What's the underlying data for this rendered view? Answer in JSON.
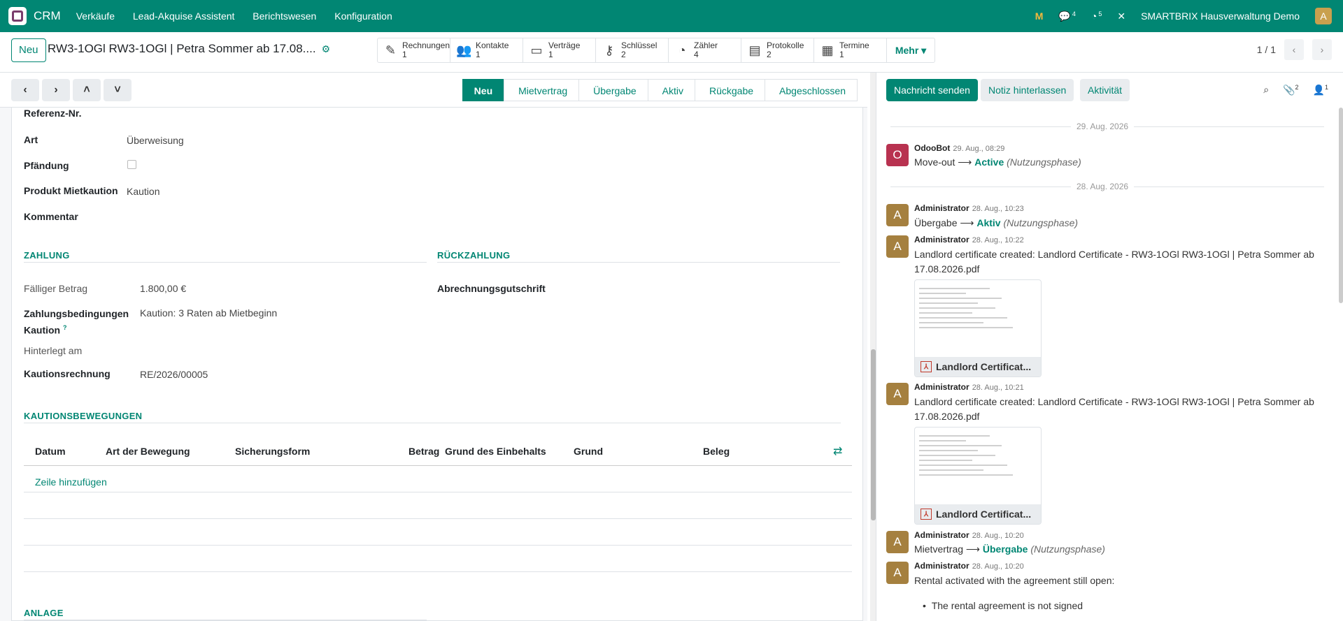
{
  "topbar": {
    "app": "CRM",
    "menu": [
      "Verkäufe",
      "Lead-Akquise Assistent",
      "Berichtswesen",
      "Konfiguration"
    ],
    "chat_badge": "4",
    "activity_badge": "5",
    "company": "SMARTBRIX Hausverwaltung Demo",
    "avatar": "A"
  },
  "control": {
    "new_label": "Neu",
    "record_title": "RW3-1OGl RW3-1OGl | Petra Sommer ab 17.08....",
    "pager": "1 / 1",
    "smart_buttons": [
      {
        "label": "Rechnungen",
        "count": "1",
        "icon": "✎"
      },
      {
        "label": "Kontakte",
        "count": "1",
        "icon": "👥"
      },
      {
        "label": "Verträge",
        "count": "1",
        "icon": "▭"
      },
      {
        "label": "Schlüssel",
        "count": "2",
        "icon": "⚷"
      },
      {
        "label": "Zähler",
        "count": "4",
        "icon": "◔"
      },
      {
        "label": "Protokolle",
        "count": "2",
        "icon": "▤"
      },
      {
        "label": "Termine",
        "count": "1",
        "icon": "▦"
      }
    ],
    "more_label": "Mehr"
  },
  "status": [
    "Neu",
    "Mietvertrag",
    "Übergabe",
    "Aktiv",
    "Rückgabe",
    "Abgeschlossen"
  ],
  "form": {
    "ref_label": "Referenz-Nr.",
    "art_label": "Art",
    "art_value": "Überweisung",
    "pfaendung_label": "Pfändung",
    "produkt_label": "Produkt Mietkaution",
    "produkt_value": "Kaution",
    "kommentar_label": "Kommentar",
    "zahlung_title": "ZAHLUNG",
    "rueck_title": "RÜCKZAHLUNG",
    "faellig_label": "Fälliger Betrag",
    "faellig_value": "1.800,00 €",
    "zb_label_1": "Zahlungsbedingungen",
    "zb_label_2": "Kaution",
    "zb_q": "?",
    "zb_value": "Kaution: 3 Raten ab Mietbeginn",
    "hinterlegt_label": "Hinterlegt am",
    "krech_label": "Kautionsrechnung",
    "krech_value": "RE/2026/00005",
    "abrech_label": "Abrechnungsgutschrift",
    "bew_title": "KAUTIONSBEWEGUNGEN",
    "columns": [
      "Datum",
      "Art der Bewegung",
      "Sicherungsform",
      "Betrag",
      "Grund des Einbehalts",
      "Grund",
      "Beleg"
    ],
    "add_line": "Zeile hinzufügen",
    "anlage_title": "ANLAGE"
  },
  "chatter": {
    "send": "Nachricht senden",
    "note": "Notiz hinterlassen",
    "activity": "Aktivität",
    "att_count": "2",
    "follow_count": "1",
    "date1": "29. Aug. 2026",
    "date2": "28. Aug. 2026",
    "m1": {
      "author": "OdooBot",
      "time": "29. Aug., 08:29",
      "from": "Move-out",
      "to": "Active",
      "phase": "(Nutzungsphase)",
      "av": "O"
    },
    "m2": {
      "author": "Administrator",
      "time": "28. Aug., 10:23",
      "from": "Übergabe",
      "to": "Aktiv",
      "phase": "(Nutzungsphase)",
      "av": "A"
    },
    "m3": {
      "author": "Administrator",
      "time": "28. Aug., 10:22",
      "text": "Landlord certificate created: Landlord Certificate - RW3-1OGl RW3-1OGl | Petra Sommer ab 17.08.2026.pdf",
      "att": "Landlord Certificat...",
      "av": "A"
    },
    "m4": {
      "author": "Administrator",
      "time": "28. Aug., 10:21",
      "text": "Landlord certificate created: Landlord Certificate - RW3-1OGl RW3-1OGl | Petra Sommer ab 17.08.2026.pdf",
      "att": "Landlord Certificat...",
      "av": "A"
    },
    "m5": {
      "author": "Administrator",
      "time": "28. Aug., 10:20",
      "from": "Mietvertrag",
      "to": "Übergabe",
      "phase": "(Nutzungsphase)",
      "av": "A"
    },
    "m6": {
      "author": "Administrator",
      "time": "28. Aug., 10:20",
      "text": "Rental activated with the agreement still open:",
      "bullet": "The rental agreement is not signed",
      "av": "A"
    }
  },
  "colors": {
    "brand": "#018673",
    "odoobot": "#b83250",
    "admin": "#a5803f"
  }
}
